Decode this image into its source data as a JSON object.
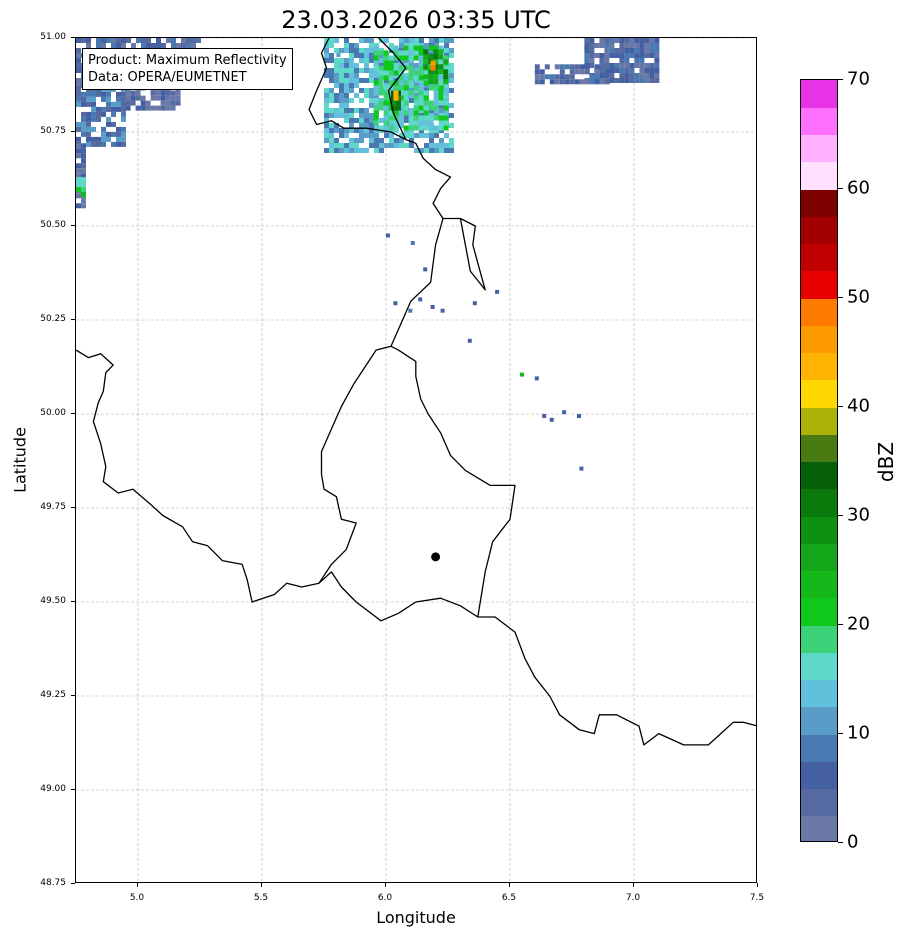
{
  "title": "23.03.2026 03:35 UTC",
  "xlabel": "Longitude",
  "ylabel": "Latitude",
  "info": {
    "product": "Product: Maximum Reflectivity",
    "data": "Data: OPERA/EUMETNET"
  },
  "x_ticks": [
    "5.0",
    "5.5",
    "6.0",
    "6.5",
    "7.0",
    "7.5"
  ],
  "y_ticks": [
    "51.00",
    "50.75",
    "50.50",
    "50.25",
    "50.00",
    "49.75",
    "49.50",
    "49.25",
    "49.00",
    "48.75"
  ],
  "extent": {
    "lon": [
      4.75,
      7.5
    ],
    "lat": [
      48.75,
      51.0
    ]
  },
  "station": {
    "lon": 6.2,
    "lat": 49.62,
    "name": "station-marker"
  },
  "colorbar": {
    "label": "dBZ",
    "range": [
      0,
      70
    ],
    "ticks": [
      "0",
      "10",
      "20",
      "30",
      "40",
      "50",
      "60",
      "70"
    ],
    "colors": [
      "#6a78a8",
      "#546aa0",
      "#4460a2",
      "#4a78b0",
      "#5a9cc8",
      "#62c0dc",
      "#5ed8c8",
      "#3cd27a",
      "#10c81c",
      "#14b81a",
      "#12a618",
      "#0e9012",
      "#0a7a0c",
      "#06600a",
      "#4a7a12",
      "#aab20a",
      "#fed600",
      "#feb400",
      "#fe9a00",
      "#fe7a00",
      "#e80000",
      "#c00000",
      "#a20000",
      "#7e0000",
      "#ffe0ff",
      "#ffb0ff",
      "#ff70ff",
      "#e832e8"
    ]
  },
  "borders": [
    [
      [
        4.75,
        50.17
      ],
      [
        4.8,
        50.15
      ],
      [
        4.85,
        50.16
      ],
      [
        4.9,
        50.13
      ],
      [
        4.87,
        50.11
      ],
      [
        4.86,
        50.06
      ],
      [
        4.84,
        50.03
      ],
      [
        4.82,
        49.98
      ],
      [
        4.85,
        49.92
      ],
      [
        4.87,
        49.86
      ],
      [
        4.86,
        49.82
      ],
      [
        4.92,
        49.79
      ],
      [
        4.98,
        49.8
      ],
      [
        5.05,
        49.76
      ],
      [
        5.1,
        49.73
      ],
      [
        5.18,
        49.7
      ],
      [
        5.22,
        49.66
      ],
      [
        5.28,
        49.65
      ],
      [
        5.34,
        49.61
      ],
      [
        5.42,
        49.6
      ],
      [
        5.44,
        49.56
      ],
      [
        5.46,
        49.5
      ],
      [
        5.55,
        49.52
      ],
      [
        5.6,
        49.55
      ],
      [
        5.66,
        49.54
      ],
      [
        5.73,
        49.55
      ],
      [
        5.78,
        49.58
      ],
      [
        5.82,
        49.54
      ],
      [
        5.88,
        49.5
      ],
      [
        5.98,
        49.45
      ],
      [
        6.05,
        49.47
      ],
      [
        6.12,
        49.5
      ],
      [
        6.22,
        49.51
      ],
      [
        6.3,
        49.49
      ],
      [
        6.37,
        49.46
      ],
      [
        6.44,
        49.46
      ],
      [
        6.52,
        49.42
      ],
      [
        6.56,
        49.35
      ],
      [
        6.6,
        49.3
      ],
      [
        6.66,
        49.25
      ],
      [
        6.7,
        49.2
      ],
      [
        6.78,
        49.16
      ],
      [
        6.84,
        49.15
      ],
      [
        6.86,
        49.2
      ],
      [
        6.93,
        49.2
      ],
      [
        7.02,
        49.17
      ],
      [
        7.04,
        49.12
      ],
      [
        7.1,
        49.15
      ],
      [
        7.2,
        49.12
      ],
      [
        7.3,
        49.12
      ],
      [
        7.35,
        49.15
      ],
      [
        7.4,
        49.18
      ],
      [
        7.44,
        49.18
      ],
      [
        7.5,
        49.17
      ]
    ],
    [
      [
        5.73,
        49.55
      ],
      [
        5.78,
        49.6
      ],
      [
        5.84,
        49.64
      ],
      [
        5.88,
        49.71
      ],
      [
        5.82,
        49.72
      ],
      [
        5.8,
        49.78
      ],
      [
        5.75,
        49.8
      ],
      [
        5.74,
        49.84
      ],
      [
        5.74,
        49.9
      ],
      [
        5.78,
        49.96
      ],
      [
        5.82,
        50.02
      ],
      [
        5.87,
        50.08
      ],
      [
        5.96,
        50.17
      ],
      [
        6.02,
        50.18
      ],
      [
        6.05,
        50.17
      ],
      [
        6.12,
        50.14
      ],
      [
        6.12,
        50.1
      ],
      [
        6.14,
        50.04
      ],
      [
        6.17,
        50.0
      ],
      [
        6.22,
        49.95
      ],
      [
        6.26,
        49.89
      ],
      [
        6.32,
        49.85
      ],
      [
        6.42,
        49.81
      ],
      [
        6.52,
        49.81
      ],
      [
        6.5,
        49.72
      ],
      [
        6.43,
        49.66
      ],
      [
        6.4,
        49.58
      ],
      [
        6.37,
        49.46
      ]
    ],
    [
      [
        6.02,
        50.18
      ],
      [
        6.06,
        50.24
      ],
      [
        6.1,
        50.3
      ],
      [
        6.18,
        50.35
      ],
      [
        6.2,
        50.45
      ],
      [
        6.23,
        50.52
      ],
      [
        6.3,
        50.52
      ],
      [
        6.36,
        50.5
      ],
      [
        6.35,
        50.45
      ],
      [
        6.4,
        50.33
      ],
      [
        6.34,
        50.38
      ],
      [
        6.3,
        50.52
      ]
    ],
    [
      [
        6.23,
        50.52
      ],
      [
        6.19,
        50.56
      ],
      [
        6.22,
        50.6
      ],
      [
        6.26,
        50.63
      ],
      [
        6.2,
        50.65
      ],
      [
        6.15,
        50.68
      ],
      [
        6.12,
        50.72
      ],
      [
        6.08,
        50.73
      ],
      [
        6.02,
        50.75
      ],
      [
        5.92,
        50.76
      ],
      [
        5.83,
        50.76
      ],
      [
        5.78,
        50.78
      ],
      [
        5.72,
        50.77
      ],
      [
        5.69,
        50.81
      ],
      [
        5.72,
        50.86
      ],
      [
        5.76,
        50.92
      ],
      [
        5.74,
        50.96
      ],
      [
        5.77,
        51.0
      ]
    ],
    [
      [
        6.08,
        50.73
      ],
      [
        6.03,
        50.8
      ],
      [
        6.01,
        50.86
      ],
      [
        6.08,
        50.92
      ],
      [
        6.03,
        50.96
      ],
      [
        5.97,
        51.0
      ]
    ]
  ],
  "radar_cells": [
    {
      "lon": [
        4.75,
        5.25
      ],
      "lat": [
        50.87,
        51.0
      ],
      "level": 2
    },
    {
      "lon": [
        4.75,
        4.95
      ],
      "lat": [
        50.72,
        50.87
      ],
      "level": 3
    },
    {
      "lon": [
        4.95,
        5.16
      ],
      "lat": [
        50.82,
        50.9
      ],
      "level": 1
    },
    {
      "lon": [
        4.75,
        4.78
      ],
      "lat": [
        50.56,
        50.72
      ],
      "level": 1
    },
    {
      "lon": [
        4.75,
        4.78
      ],
      "lat": [
        50.58,
        50.63
      ],
      "level": 8
    },
    {
      "lon": [
        5.75,
        6.27
      ],
      "lat": [
        50.7,
        51.0
      ],
      "level": 5
    },
    {
      "lon": [
        5.95,
        6.25
      ],
      "lat": [
        50.76,
        50.98
      ],
      "level": 7
    },
    {
      "lon": [
        6.15,
        6.25
      ],
      "lat": [
        50.88,
        50.97
      ],
      "level": 11
    },
    {
      "lon": [
        6.02,
        6.06
      ],
      "lat": [
        50.82,
        50.86
      ],
      "level": 13
    },
    {
      "lon": [
        6.18,
        6.2
      ],
      "lat": [
        50.92,
        50.94
      ],
      "level": 20
    },
    {
      "lon": [
        6.03,
        6.05
      ],
      "lat": [
        50.84,
        50.86
      ],
      "level": 16
    },
    {
      "lon": [
        6.8,
        7.1
      ],
      "lat": [
        50.89,
        51.0
      ],
      "level": 2
    },
    {
      "lon": [
        6.6,
        6.9
      ],
      "lat": [
        50.89,
        50.93
      ],
      "level": 2
    }
  ],
  "radar_specks": [
    {
      "lon": 6.0,
      "lat": 50.48,
      "level": 2
    },
    {
      "lon": 6.1,
      "lat": 50.46,
      "level": 3
    },
    {
      "lon": 6.15,
      "lat": 50.39,
      "level": 2
    },
    {
      "lon": 6.13,
      "lat": 50.31,
      "level": 2
    },
    {
      "lon": 6.18,
      "lat": 50.29,
      "level": 2
    },
    {
      "lon": 6.03,
      "lat": 50.3,
      "level": 2
    },
    {
      "lon": 6.22,
      "lat": 50.28,
      "level": 2
    },
    {
      "lon": 6.35,
      "lat": 50.3,
      "level": 2
    },
    {
      "lon": 6.33,
      "lat": 50.2,
      "level": 2
    },
    {
      "lon": 6.44,
      "lat": 50.33,
      "level": 2
    },
    {
      "lon": 6.54,
      "lat": 50.11,
      "level": 9
    },
    {
      "lon": 6.6,
      "lat": 50.1,
      "level": 2
    },
    {
      "lon": 6.63,
      "lat": 50.0,
      "level": 2
    },
    {
      "lon": 6.66,
      "lat": 49.99,
      "level": 2
    },
    {
      "lon": 6.71,
      "lat": 50.01,
      "level": 2
    },
    {
      "lon": 6.77,
      "lat": 50.0,
      "level": 2
    },
    {
      "lon": 6.78,
      "lat": 49.86,
      "level": 2
    },
    {
      "lon": 6.8,
      "lat": 50.98,
      "level": 2
    },
    {
      "lon": 5.8,
      "lat": 50.96,
      "level": 4
    },
    {
      "lon": 6.09,
      "lat": 50.28,
      "level": 3
    }
  ]
}
